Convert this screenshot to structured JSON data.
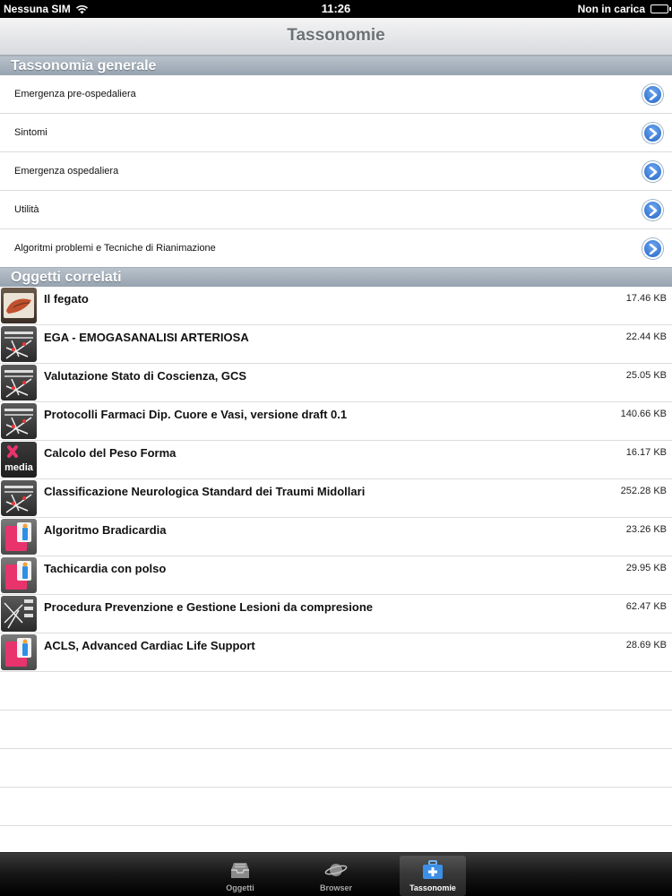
{
  "status": {
    "carrier": "Nessuna SIM",
    "time": "11:26",
    "battery_text": "Non in carica"
  },
  "navbar": {
    "title": "Tassonomie"
  },
  "sections": {
    "general_title": "Tassonomia generale",
    "related_title": "Oggetti correlati"
  },
  "taxonomies": [
    "Emergenza pre-ospedaliera",
    "Sintomi",
    "Emergenza ospedaliera",
    "Utilità",
    "Algoritmi problemi e Tecniche di Rianimazione"
  ],
  "objects": [
    {
      "name": "Il fegato",
      "size": "17.46 KB",
      "icon": "liver-image-icon"
    },
    {
      "name": "EGA - EMOGASANALISI ARTERIOSA",
      "size": "22.44 KB",
      "icon": "flowchart-icon"
    },
    {
      "name": "Valutazione Stato di Coscienza, GCS",
      "size": "25.05 KB",
      "icon": "flowchart-icon"
    },
    {
      "name": "Protocolli Farmaci Dip. Cuore e Vasi, versione draft 0.1",
      "size": "140.66 KB",
      "icon": "flowchart-icon"
    },
    {
      "name": "Calcolo del Peso Forma",
      "size": "16.17 KB",
      "icon": "media-icon"
    },
    {
      "name": "Classificazione Neurologica Standard dei Traumi Midollari",
      "size": "252.28 KB",
      "icon": "flowchart-icon"
    },
    {
      "name": "Algoritmo Bradicardia",
      "size": "23.26 KB",
      "icon": "document-icon"
    },
    {
      "name": "Tachicardia con polso",
      "size": "29.95 KB",
      "icon": "document-icon"
    },
    {
      "name": "Procedura Prevenzione e Gestione Lesioni da compresione",
      "size": "62.47 KB",
      "icon": "flowchart-icon"
    },
    {
      "name": "ACLS, Advanced Cardiac Life Support",
      "size": "28.69 KB",
      "icon": "document-icon"
    }
  ],
  "media_icon_text": "media",
  "tabbar": {
    "tabs": [
      {
        "label": "Oggetti",
        "icon": "inbox-icon",
        "active": false
      },
      {
        "label": "Browser",
        "icon": "planet-icon",
        "active": false
      },
      {
        "label": "Tassonomie",
        "icon": "medical-kit-icon",
        "active": true
      }
    ]
  },
  "colors": {
    "accent_blue": "#2466c8",
    "section_header": "#a5aeb8",
    "tab_active_bg": "#5a5a5a"
  }
}
